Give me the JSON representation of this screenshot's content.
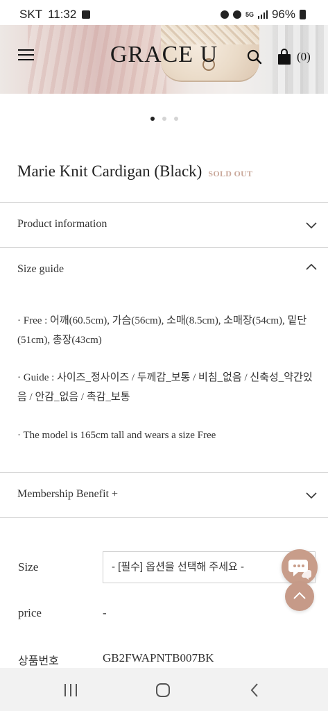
{
  "status_bar": {
    "carrier": "SKT",
    "time": "11:32",
    "network": "5G",
    "battery": "96%"
  },
  "header": {
    "logo": "GRACE U",
    "cart_count": "(0)"
  },
  "carousel": {
    "total_slides": 3,
    "active_slide": 1
  },
  "product": {
    "title": "Marie Knit Cardigan (Black)",
    "status_badge": "SOLD OUT"
  },
  "sections": {
    "product_info": "Product information",
    "size_guide": "Size guide",
    "size_guide_lines": [
      "· Free : 어깨(60.5cm), 가슴(56cm), 소매(8.5cm), 소매장(54cm), 밑단(51cm), 총장(43cm)",
      "· Guide : 사이즈_정사이즈 / 두께감_보통 / 비침_없음 / 신축성_약간있음 / 안감_없음 / 촉감_보통",
      "· The model is 165cm tall and wears a size Free"
    ],
    "membership": "Membership Benefit +"
  },
  "options": {
    "size_label": "Size",
    "size_select_value": "- [필수] 옵션을 선택해 주세요 -",
    "price_label": "price",
    "price_value": "-",
    "code_label": "상품번호",
    "code_value": "GB2FWAPNTB007BK"
  },
  "colors": {
    "accent": "#c89d8a",
    "soldout": "#c9a89a",
    "divider": "#d8d8d8"
  }
}
